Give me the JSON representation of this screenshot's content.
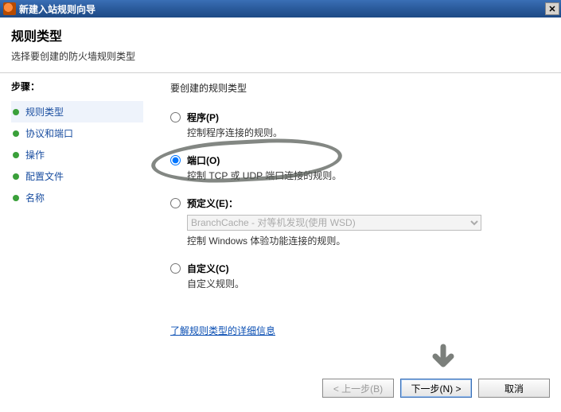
{
  "window": {
    "title": "新建入站规则向导",
    "close_label": "✕"
  },
  "header": {
    "title": "规则类型",
    "subtitle": "选择要创建的防火墙规则类型"
  },
  "sidebar": {
    "heading": "步骤：",
    "items": [
      {
        "label": "规则类型"
      },
      {
        "label": "协议和端口"
      },
      {
        "label": "操作"
      },
      {
        "label": "配置文件"
      },
      {
        "label": "名称"
      }
    ],
    "current_index": 0
  },
  "main": {
    "heading": "要创建的规则类型",
    "options": [
      {
        "id": "program",
        "label": "程序(P)",
        "desc": "控制程序连接的规则。",
        "checked": false
      },
      {
        "id": "port",
        "label": "端口(O)",
        "desc": "控制 TCP 或 UDP 端口连接的规则。",
        "checked": true
      },
      {
        "id": "predefined",
        "label": "预定义(E)：",
        "desc": "控制 Windows 体验功能连接的规则。",
        "checked": false,
        "dropdown_selected": "BranchCache - 对等机发现(使用 WSD)",
        "dropdown_disabled": true
      },
      {
        "id": "custom",
        "label": "自定义(C)",
        "desc": "自定义规则。",
        "checked": false
      }
    ],
    "help_link": "了解规则类型的详细信息"
  },
  "buttons": {
    "back": "< 上一步(B)",
    "back_disabled": true,
    "next": "下一步(N) >",
    "cancel": "取消"
  }
}
